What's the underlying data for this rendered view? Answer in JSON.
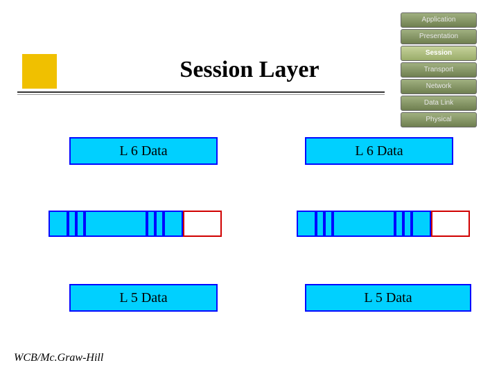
{
  "title": "Session Layer",
  "osi_layers": [
    {
      "name": "Application",
      "highlight": false
    },
    {
      "name": "Presentation",
      "highlight": false
    },
    {
      "name": "Session",
      "highlight": true
    },
    {
      "name": "Transport",
      "highlight": false
    },
    {
      "name": "Network",
      "highlight": false
    },
    {
      "name": "Data Link",
      "highlight": false
    },
    {
      "name": "Physical",
      "highlight": false
    }
  ],
  "boxes": {
    "l6_left": "L 6 Data",
    "l6_right": "L 6 Data",
    "l5_left": "L 5 Data",
    "l5_right": "L 5 Data"
  },
  "footer": "WCB/Mc.Graw-Hill"
}
